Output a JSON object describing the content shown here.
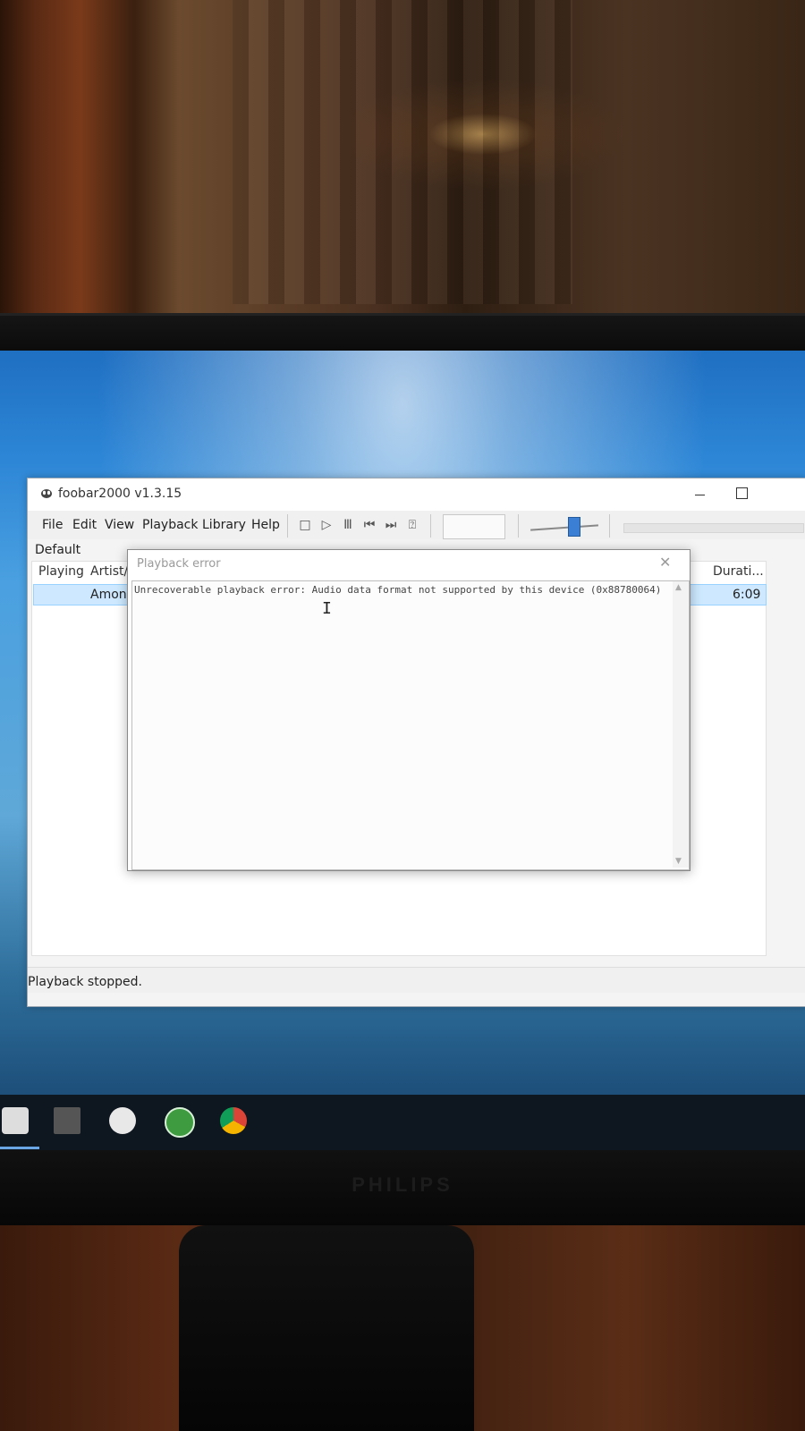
{
  "window": {
    "title": "foobar2000 v1.3.15",
    "menu": [
      "File",
      "Edit",
      "View",
      "Playback",
      "Library",
      "Help"
    ]
  },
  "toolbar": {
    "icons": [
      "stop-icon",
      "play-icon",
      "pause-icon",
      "previous-icon",
      "next-icon",
      "random-icon"
    ],
    "stop_glyph": "□",
    "play_glyph": "▷",
    "pause_glyph": "Ⅲ",
    "prev_glyph": "⏮",
    "next_glyph": "⏭",
    "random_glyph": "⍰"
  },
  "playlist": {
    "tab": "Default",
    "columns": {
      "playing": "Playing",
      "artist": "Artist/a",
      "duration": "Durati..."
    },
    "rows": [
      {
        "artist": "Amon",
        "duration": "6:09"
      }
    ]
  },
  "status": {
    "text": "Playback stopped."
  },
  "error_dialog": {
    "title": "Playback error",
    "close_glyph": "✕",
    "message": "Unrecoverable playback error: Audio data format not supported by this device (0x88780064)"
  },
  "monitor": {
    "brand": "PHILIPS"
  },
  "taskbar": {
    "items": [
      "foobar2000-icon",
      "foobar-tray-icon",
      "clock-app-icon",
      "utorrent-icon",
      "chrome-icon"
    ]
  },
  "colors": {
    "selection": "#cde8ff",
    "accent": "#3b7fd4"
  }
}
